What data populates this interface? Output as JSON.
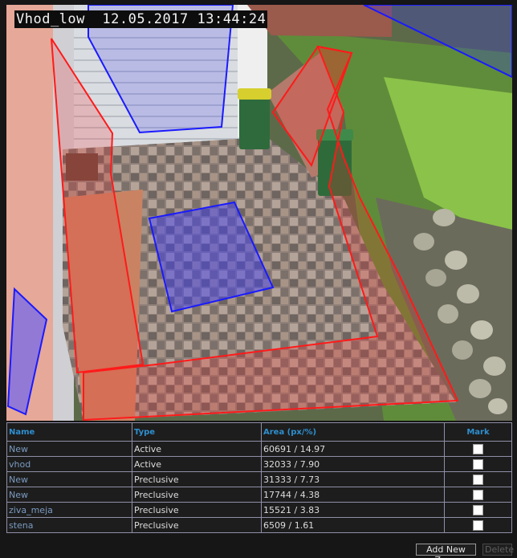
{
  "camera": {
    "camera_name": "Vhod_low",
    "date": "12.05.2017",
    "time": "13:44:24"
  },
  "zones_table": {
    "columns": [
      "Name",
      "Type",
      "Area (px/%)",
      "Mark"
    ],
    "rows": [
      {
        "name": "New",
        "type": "Active",
        "area": "60691 / 14.97"
      },
      {
        "name": "vhod",
        "type": "Active",
        "area": "32033 / 7.90"
      },
      {
        "name": "New",
        "type": "Preclusive",
        "area": "31333 / 7.73"
      },
      {
        "name": "New",
        "type": "Preclusive",
        "area": "17744 / 4.38"
      },
      {
        "name": "ziva_meja",
        "type": "Preclusive",
        "area": "15521 / 3.83"
      },
      {
        "name": "stena",
        "type": "Preclusive",
        "area": "6509 / 1.61"
      }
    ]
  },
  "buttons": {
    "add_new_zone": "Add New Zone",
    "delete": "Delete"
  },
  "colors": {
    "active_zone": "#ff1a1a",
    "preclusive_zone": "#1a1aff",
    "header_text": "#2e8fcf"
  }
}
